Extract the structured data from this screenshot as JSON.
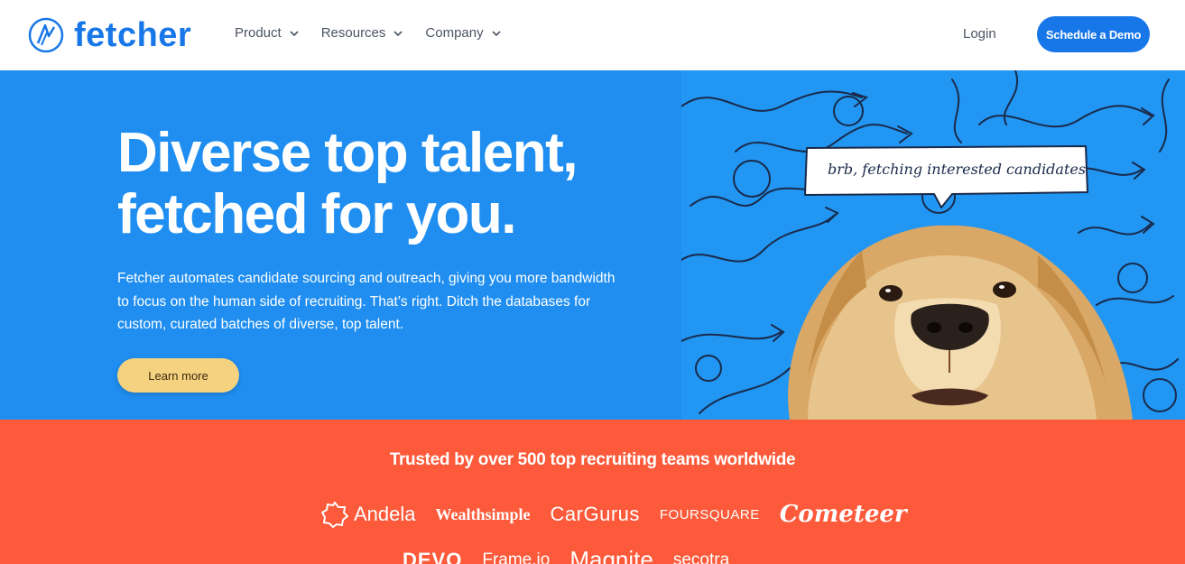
{
  "header": {
    "brand": "fetcher",
    "nav": [
      {
        "label": "Product"
      },
      {
        "label": "Resources"
      },
      {
        "label": "Company"
      }
    ],
    "login_label": "Login",
    "demo_label": "Schedule a Demo"
  },
  "hero": {
    "title_line1": "Diverse top talent,",
    "title_line2": "fetched for you.",
    "description": "Fetcher automates candidate sourcing and outreach, giving you more bandwidth to focus on the human side of recruiting. That’s right. Ditch the databases for custom, curated batches of diverse, top talent.",
    "learn_more_label": "Learn more",
    "bubble_text": "brb, fetching interested candidates"
  },
  "trusted": {
    "title": "Trusted by over 500 top recruiting teams worldwide",
    "logos_row1": [
      "Andela",
      "Wealthsimple",
      "CarGurus",
      "FOURSQUARE",
      "Cometeer"
    ],
    "logos_row2": [
      "DEVO",
      "Frame.io",
      "Magnite",
      "secotra"
    ]
  },
  "colors": {
    "brand_blue": "#1877e8",
    "hero_blue": "#1f8ef0",
    "cta_yellow": "#f5d27f",
    "trusted_orange": "#fc5a3a"
  }
}
